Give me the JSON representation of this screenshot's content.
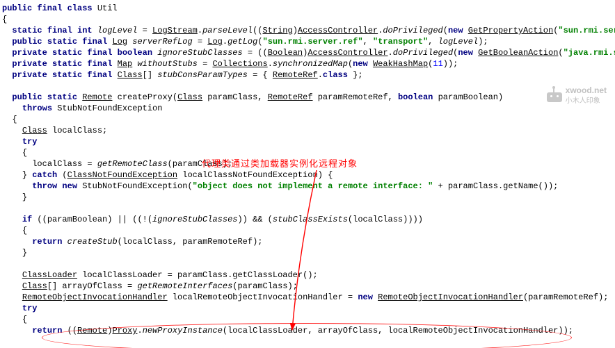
{
  "annotation_text": "代理类通过类加载器实例化远程对象",
  "watermark": {
    "line1": "xwood.net",
    "line2": "小木人印象"
  },
  "code": {
    "l1_a": "public final class",
    "l1_b": "Util",
    "l2": "{",
    "l3_a": "static final int",
    "l3_b": "logLevel",
    "l3_c": " = ",
    "l3_d": "LogStream",
    "l3_e": ".",
    "l3_f": "parseLevel",
    "l3_g": "((",
    "l3_h": "String",
    "l3_i": ")",
    "l3_j": "AccessController",
    "l3_k": ".",
    "l3_l": "doPrivileged",
    "l3_m": "(",
    "l3_n": "new",
    "l3_o": " ",
    "l3_p": "GetPropertyAction",
    "l3_q": "(",
    "l3_r": "\"sun.rmi.serve",
    "l4_a": "public static final",
    "l4_b": "Log",
    "l4_c": "serverRefLog",
    "l4_d": " = ",
    "l4_e": "Log",
    "l4_f": ".",
    "l4_g": "getLog",
    "l4_h": "(",
    "l4_i": "\"sun.rmi.server.ref\"",
    "l4_j": ", ",
    "l4_k": "\"transport\"",
    "l4_l": ", ",
    "l4_m": "logLevel",
    "l4_n": ");",
    "l5_a": "private static final boolean",
    "l5_b": "ignoreStubClasses",
    "l5_c": " = ((",
    "l5_d": "Boolean",
    "l5_e": ")",
    "l5_f": "AccessController",
    "l5_g": ".",
    "l5_h": "doPrivileged",
    "l5_i": "(",
    "l5_j": "new",
    "l5_k": " ",
    "l5_l": "GetBooleanAction",
    "l5_m": "(",
    "l5_n": "\"java.rmi.ser",
    "l6_a": "private static final",
    "l6_b": "Map",
    "l6_c": "withoutStubs",
    "l6_d": " = ",
    "l6_e": "Collections",
    "l6_f": ".",
    "l6_g": "synchronizedMap",
    "l6_h": "(",
    "l6_i": "new",
    "l6_j": " ",
    "l6_k": "WeakHashMap",
    "l6_l": "(",
    "l6_m": "11",
    "l6_n": "));",
    "l7_a": "private static final",
    "l7_b": "Class",
    "l7_c": "[] ",
    "l7_d": "stubConsParamTypes",
    "l7_e": " = { ",
    "l7_f": "RemoteRef",
    "l7_g": ".",
    "l7_h": "class",
    "l7_i": " };",
    "l9_a": "public static",
    "l9_b": "Remote",
    "l9_c": " createProxy(",
    "l9_d": "Class",
    "l9_e": " paramClass, ",
    "l9_f": "RemoteRef",
    "l9_g": " paramRemoteRef, ",
    "l9_h": "boolean",
    "l9_i": " paramBoolean)",
    "l10_a": "throws",
    "l10_b": " StubNotFoundException",
    "l11": "{",
    "l12_a": "Class",
    "l12_b": " localClass;",
    "l13": "try",
    "l14": "{",
    "l15_a": "localClass = ",
    "l15_b": "getRemoteClass",
    "l15_c": "(paramClass);",
    "l16_a": "} ",
    "l16_b": "catch",
    "l16_c": " (",
    "l16_d": "ClassNotFoundException",
    "l16_e": " localClassNotFoundException) {",
    "l17_a": "throw new",
    "l17_b": " StubNotFoundException(",
    "l17_c": "\"object does not implement a remote interface: \"",
    "l17_d": " + paramClass.getName());",
    "l18": "}",
    "l20_a": "if",
    "l20_b": " ((paramBoolean) || ((!(",
    "l20_c": "ignoreStubClasses",
    "l20_d": ")) && (",
    "l20_e": "stubClassExists",
    "l20_f": "(localClass))))",
    "l21": "{",
    "l22_a": "return",
    "l22_b": " ",
    "l22_c": "createStub",
    "l22_d": "(localClass, paramRemoteRef);",
    "l23": "}",
    "l25_a": "ClassLoader",
    "l25_b": " localClassLoader = paramClass.getClassLoader();",
    "l26_a": "Class",
    "l26_b": "[] arrayOfClass = ",
    "l26_c": "getRemoteInterfaces",
    "l26_d": "(paramClass);",
    "l27_a": "RemoteObjectInvocationHandler",
    "l27_b": " localRemoteObjectInvocationHandler = ",
    "l27_c": "new",
    "l27_d": " ",
    "l27_e": "RemoteObjectInvocationHandler",
    "l27_f": "(paramRemoteRef);",
    "l28": "try",
    "l29": "{",
    "l30_a": "return",
    "l30_b": " ((",
    "l30_c": "Remote",
    "l30_d": ")",
    "l30_e": "Proxy",
    "l30_f": ".",
    "l30_g": "newProxyInstance",
    "l30_h": "(localClassLoader, arrayOfClass, localRemoteObjectInvocationHandler));"
  }
}
